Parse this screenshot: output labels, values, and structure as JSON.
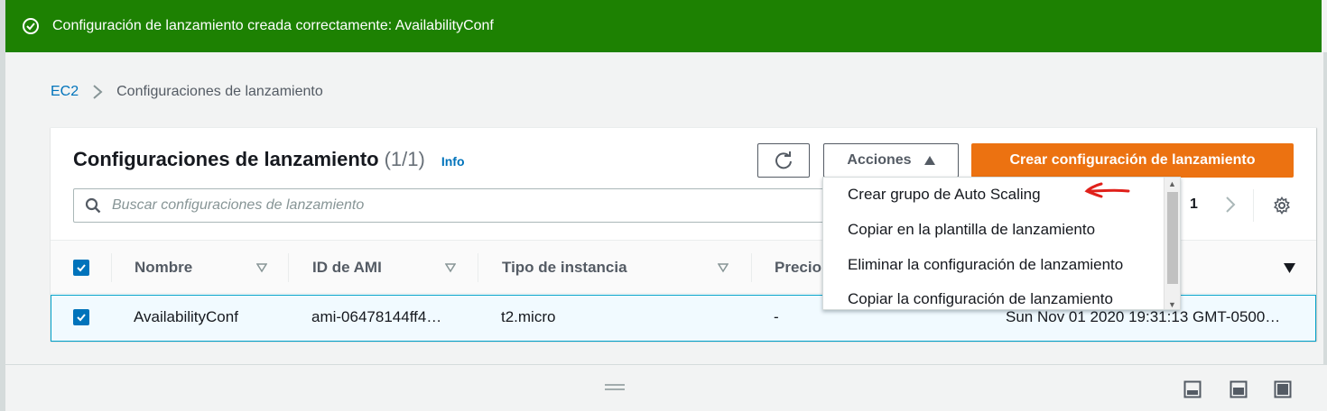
{
  "flash": {
    "message": "Configuración de lanzamiento creada correctamente: AvailabilityConf",
    "icon": "check-circle-icon",
    "color": "#1d8102"
  },
  "breadcrumb": {
    "root": "EC2",
    "current": "Configuraciones de lanzamiento"
  },
  "panel": {
    "title": "Configuraciones de lanzamiento",
    "count": "(1/1)",
    "info": "Info"
  },
  "toolbar": {
    "actions_label": "Acciones",
    "create_label": "Crear configuración de lanzamiento",
    "primary_color": "#ec7211"
  },
  "search": {
    "placeholder": "Buscar configuraciones de lanzamiento"
  },
  "pagination": {
    "current_page": "1"
  },
  "table": {
    "columns": [
      "Nombre",
      "ID de AMI",
      "Tipo de instancia",
      "Precio"
    ],
    "rows": [
      {
        "name": "AvailabilityConf",
        "ami_id": "ami-06478144ff4…",
        "instance_type": "t2.micro",
        "price": "-",
        "created": "Sun Nov 01 2020 19:31:13 GMT-0500…",
        "selected": true
      }
    ]
  },
  "actions_menu": {
    "items": [
      "Crear grupo de Auto Scaling",
      "Copiar en la plantilla de lanzamiento",
      "Eliminar la configuración de lanzamiento",
      "Copiar la configuración de lanzamiento"
    ]
  }
}
